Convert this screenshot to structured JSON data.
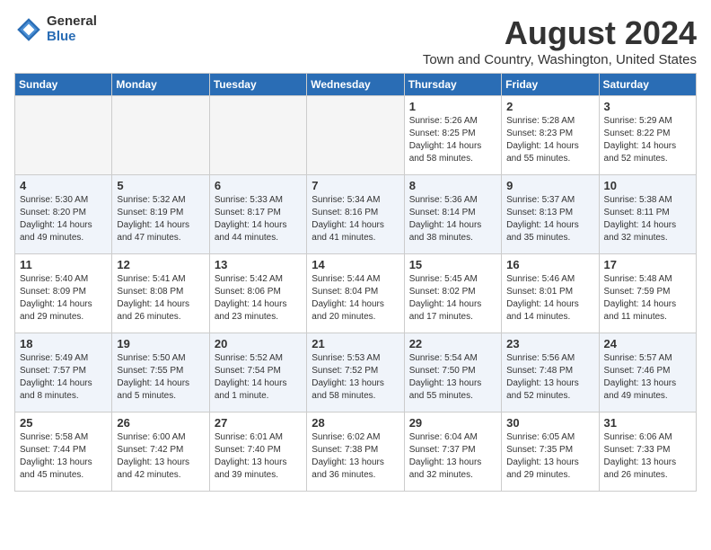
{
  "logo": {
    "general": "General",
    "blue": "Blue"
  },
  "title": "August 2024",
  "subtitle": "Town and Country, Washington, United States",
  "headers": [
    "Sunday",
    "Monday",
    "Tuesday",
    "Wednesday",
    "Thursday",
    "Friday",
    "Saturday"
  ],
  "weeks": [
    [
      {
        "day": "",
        "info": ""
      },
      {
        "day": "",
        "info": ""
      },
      {
        "day": "",
        "info": ""
      },
      {
        "day": "",
        "info": ""
      },
      {
        "day": "1",
        "info": "Sunrise: 5:26 AM\nSunset: 8:25 PM\nDaylight: 14 hours\nand 58 minutes."
      },
      {
        "day": "2",
        "info": "Sunrise: 5:28 AM\nSunset: 8:23 PM\nDaylight: 14 hours\nand 55 minutes."
      },
      {
        "day": "3",
        "info": "Sunrise: 5:29 AM\nSunset: 8:22 PM\nDaylight: 14 hours\nand 52 minutes."
      }
    ],
    [
      {
        "day": "4",
        "info": "Sunrise: 5:30 AM\nSunset: 8:20 PM\nDaylight: 14 hours\nand 49 minutes."
      },
      {
        "day": "5",
        "info": "Sunrise: 5:32 AM\nSunset: 8:19 PM\nDaylight: 14 hours\nand 47 minutes."
      },
      {
        "day": "6",
        "info": "Sunrise: 5:33 AM\nSunset: 8:17 PM\nDaylight: 14 hours\nand 44 minutes."
      },
      {
        "day": "7",
        "info": "Sunrise: 5:34 AM\nSunset: 8:16 PM\nDaylight: 14 hours\nand 41 minutes."
      },
      {
        "day": "8",
        "info": "Sunrise: 5:36 AM\nSunset: 8:14 PM\nDaylight: 14 hours\nand 38 minutes."
      },
      {
        "day": "9",
        "info": "Sunrise: 5:37 AM\nSunset: 8:13 PM\nDaylight: 14 hours\nand 35 minutes."
      },
      {
        "day": "10",
        "info": "Sunrise: 5:38 AM\nSunset: 8:11 PM\nDaylight: 14 hours\nand 32 minutes."
      }
    ],
    [
      {
        "day": "11",
        "info": "Sunrise: 5:40 AM\nSunset: 8:09 PM\nDaylight: 14 hours\nand 29 minutes."
      },
      {
        "day": "12",
        "info": "Sunrise: 5:41 AM\nSunset: 8:08 PM\nDaylight: 14 hours\nand 26 minutes."
      },
      {
        "day": "13",
        "info": "Sunrise: 5:42 AM\nSunset: 8:06 PM\nDaylight: 14 hours\nand 23 minutes."
      },
      {
        "day": "14",
        "info": "Sunrise: 5:44 AM\nSunset: 8:04 PM\nDaylight: 14 hours\nand 20 minutes."
      },
      {
        "day": "15",
        "info": "Sunrise: 5:45 AM\nSunset: 8:02 PM\nDaylight: 14 hours\nand 17 minutes."
      },
      {
        "day": "16",
        "info": "Sunrise: 5:46 AM\nSunset: 8:01 PM\nDaylight: 14 hours\nand 14 minutes."
      },
      {
        "day": "17",
        "info": "Sunrise: 5:48 AM\nSunset: 7:59 PM\nDaylight: 14 hours\nand 11 minutes."
      }
    ],
    [
      {
        "day": "18",
        "info": "Sunrise: 5:49 AM\nSunset: 7:57 PM\nDaylight: 14 hours\nand 8 minutes."
      },
      {
        "day": "19",
        "info": "Sunrise: 5:50 AM\nSunset: 7:55 PM\nDaylight: 14 hours\nand 5 minutes."
      },
      {
        "day": "20",
        "info": "Sunrise: 5:52 AM\nSunset: 7:54 PM\nDaylight: 14 hours\nand 1 minute."
      },
      {
        "day": "21",
        "info": "Sunrise: 5:53 AM\nSunset: 7:52 PM\nDaylight: 13 hours\nand 58 minutes."
      },
      {
        "day": "22",
        "info": "Sunrise: 5:54 AM\nSunset: 7:50 PM\nDaylight: 13 hours\nand 55 minutes."
      },
      {
        "day": "23",
        "info": "Sunrise: 5:56 AM\nSunset: 7:48 PM\nDaylight: 13 hours\nand 52 minutes."
      },
      {
        "day": "24",
        "info": "Sunrise: 5:57 AM\nSunset: 7:46 PM\nDaylight: 13 hours\nand 49 minutes."
      }
    ],
    [
      {
        "day": "25",
        "info": "Sunrise: 5:58 AM\nSunset: 7:44 PM\nDaylight: 13 hours\nand 45 minutes."
      },
      {
        "day": "26",
        "info": "Sunrise: 6:00 AM\nSunset: 7:42 PM\nDaylight: 13 hours\nand 42 minutes."
      },
      {
        "day": "27",
        "info": "Sunrise: 6:01 AM\nSunset: 7:40 PM\nDaylight: 13 hours\nand 39 minutes."
      },
      {
        "day": "28",
        "info": "Sunrise: 6:02 AM\nSunset: 7:38 PM\nDaylight: 13 hours\nand 36 minutes."
      },
      {
        "day": "29",
        "info": "Sunrise: 6:04 AM\nSunset: 7:37 PM\nDaylight: 13 hours\nand 32 minutes."
      },
      {
        "day": "30",
        "info": "Sunrise: 6:05 AM\nSunset: 7:35 PM\nDaylight: 13 hours\nand 29 minutes."
      },
      {
        "day": "31",
        "info": "Sunrise: 6:06 AM\nSunset: 7:33 PM\nDaylight: 13 hours\nand 26 minutes."
      }
    ]
  ]
}
